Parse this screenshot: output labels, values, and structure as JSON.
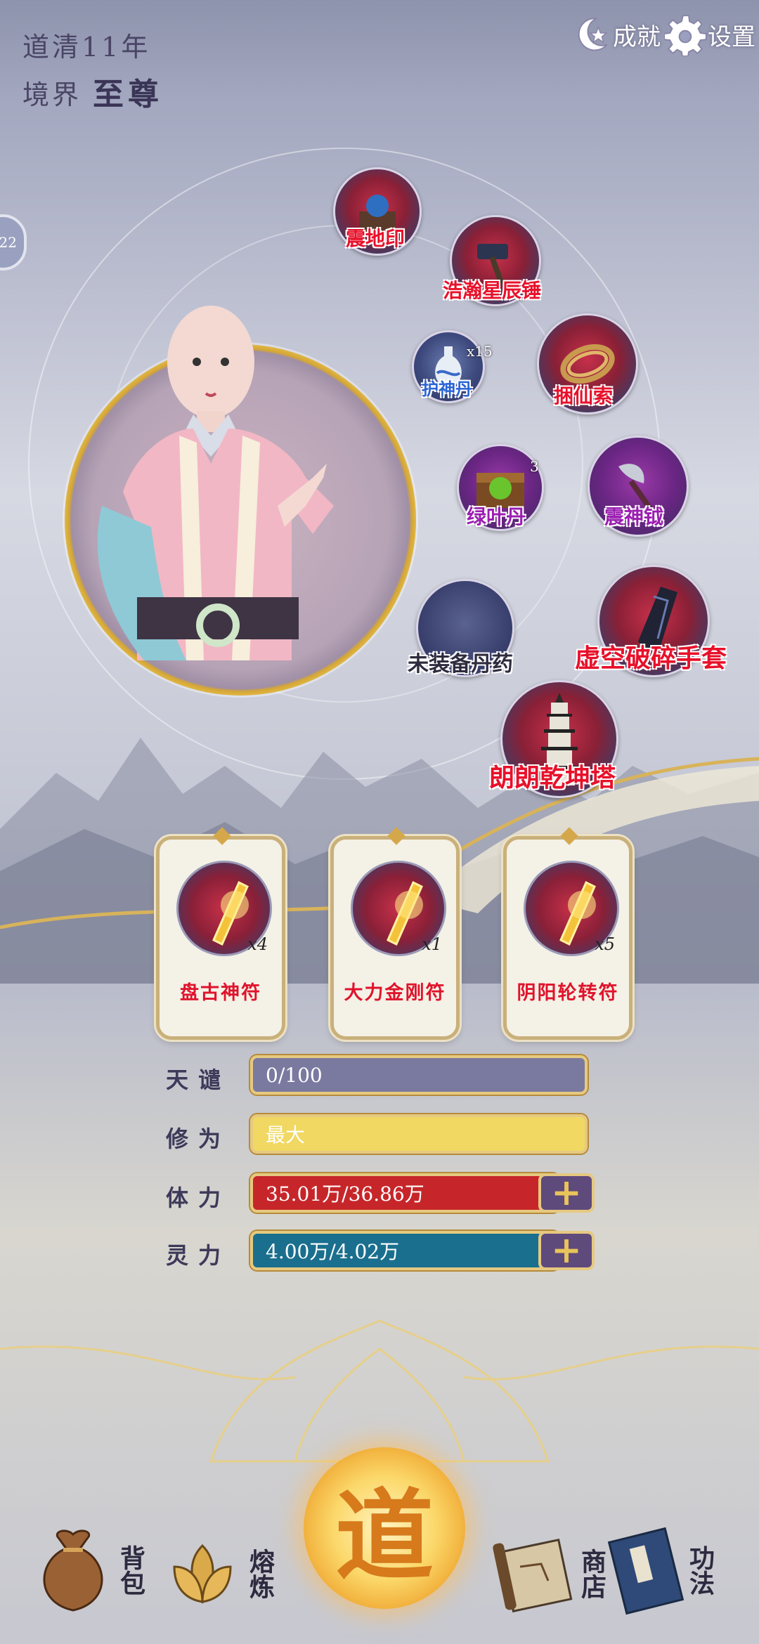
{
  "header": {
    "year": "道清11年",
    "realm_label": "境界",
    "realm_value": "至尊",
    "achievement_label": "成就",
    "settings_label": "设置"
  },
  "side_tab": {
    "label": "22"
  },
  "equipment": [
    {
      "name": "震地印",
      "color": "red"
    },
    {
      "name": "浩瀚星辰锤",
      "color": "red"
    },
    {
      "name": "护神丹",
      "color": "blue",
      "count": "x15"
    },
    {
      "name": "捆仙索",
      "color": "red"
    },
    {
      "name": "绿叶丹",
      "color": "purple",
      "count": "3"
    },
    {
      "name": "震神钺",
      "color": "purple"
    },
    {
      "name": "未装备丹药",
      "color": "dark"
    },
    {
      "name": "虚空破碎手套",
      "color": "red"
    },
    {
      "name": "朗朗乾坤塔",
      "color": "red"
    }
  ],
  "talismans": [
    {
      "name": "盘古神符",
      "count": "x4"
    },
    {
      "name": "大力金刚符",
      "count": "x1"
    },
    {
      "name": "阴阳轮转符",
      "count": "x5"
    }
  ],
  "stats": {
    "tianqian": {
      "label": "天谴",
      "text": "0/100",
      "fraction": 0.0
    },
    "xiuwei": {
      "label": "修为",
      "text": "最大",
      "fraction": 1.0
    },
    "tili": {
      "label": "体力",
      "text": "35.01万/36.86万",
      "fraction": 0.95
    },
    "lingli": {
      "label": "灵力",
      "text": "4.00万/4.02万",
      "fraction": 0.995
    }
  },
  "colors": {
    "tianqian_bar": "#7a7aa0",
    "xiuwei_bar": "#f0d862",
    "tili_bar": "#c6262a",
    "lingli_bar": "#1a6f8e",
    "equip_label_red": "#e8102a"
  },
  "nav": {
    "bag": "背包",
    "smelt": "熔炼",
    "dao": "道",
    "shop": "商店",
    "skills": "功法"
  }
}
